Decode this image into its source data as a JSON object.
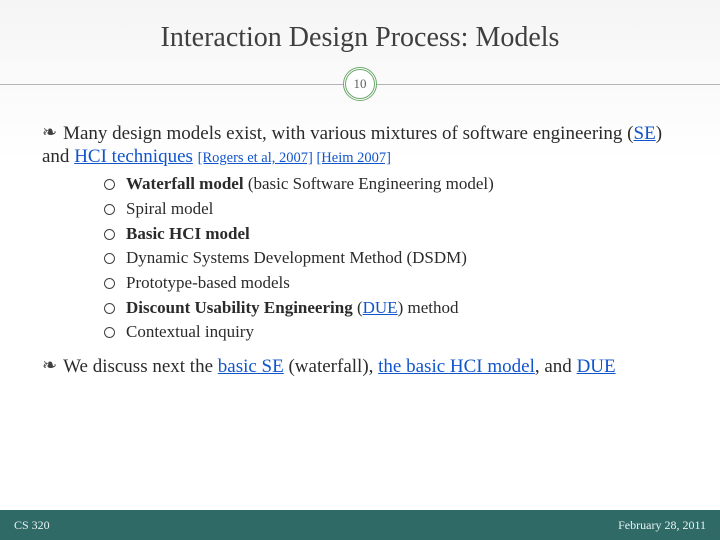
{
  "title": "Interaction Design Process: Models",
  "page_number": "10",
  "para1": {
    "lead": "Many design models exist, with various  mixtures of software engineering (",
    "se": "SE",
    "mid": ") and ",
    "hci": "HCI techniques",
    "tail": " ",
    "cite1": "[Rogers et al, 2007]",
    "cite_join": " ",
    "cite2": "[Heim 2007]"
  },
  "models": [
    {
      "pre": "",
      "bold": "Waterfall model",
      "post": " (basic Software Engineering model)"
    },
    {
      "pre": "Spiral model",
      "bold": "",
      "post": ""
    },
    {
      "pre": "",
      "bold": "Basic HCI model",
      "post": ""
    },
    {
      "pre": "Dynamic Systems Development Method (DSDM)",
      "bold": "",
      "post": ""
    },
    {
      "pre": "Prototype-based models",
      "bold": "",
      "post": ""
    },
    {
      "pre": "",
      "bold": "Discount Usability Engineering",
      "post": " (",
      "link": "DUE",
      "post2": ") method"
    },
    {
      "pre": "Contextual inquiry",
      "bold": "",
      "post": ""
    }
  ],
  "para2": {
    "lead": "We discuss next the ",
    "l1": "basic SE",
    "mid1": " (waterfall), ",
    "l2": "the basic HCI model",
    "mid2": ", and ",
    "l3": "DUE"
  },
  "footer": {
    "left": "CS 320",
    "right": "February 28, 2011"
  },
  "bullet_glyph": "❧"
}
